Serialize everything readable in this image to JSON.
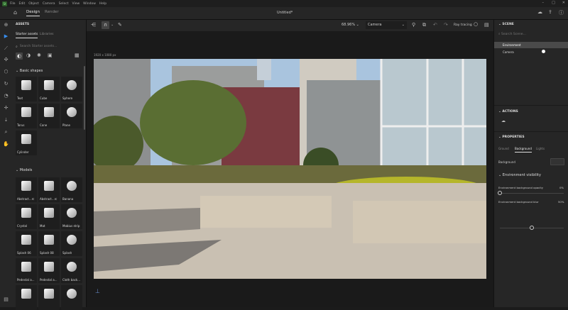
{
  "menu": {
    "items": [
      "File",
      "Edit",
      "Object",
      "Camera",
      "Select",
      "View",
      "Window",
      "Help"
    ]
  },
  "tabs": {
    "home": "home-icon",
    "items": [
      "Design",
      "Render"
    ],
    "active": "Design",
    "doc_title": "Untitled*"
  },
  "assets": {
    "header": "ASSETS",
    "tabs": [
      "Starter assets",
      "Libraries"
    ],
    "search_placeholder": "Search Starter assets...",
    "basic_title": "Basic shapes",
    "basic": [
      "Text",
      "Cube",
      "Sphere",
      "Torus",
      "Cone",
      "Plane",
      "Cylinder"
    ],
    "models_title": "Models",
    "models": [
      "Abstract...rc",
      "Abstract...rc",
      "Banana",
      "Crystal",
      "Mat",
      "Mobius strip",
      "Splash 06",
      "Splash 08",
      "Splash",
      "Pedestal a...",
      "Pedestal a...",
      "Cloth back...",
      "",
      "",
      ""
    ]
  },
  "toolbar": {
    "zoom": "68.96%",
    "camera": "Camera",
    "ray_tracing": "Ray tracing"
  },
  "viewport": {
    "resolution": "1920 x 1080 px"
  },
  "scene": {
    "header": "SCENE",
    "search_placeholder": "Search Scene...",
    "items": [
      "Environment",
      "Camera"
    ]
  },
  "actions": {
    "header": "ACTIONS"
  },
  "properties": {
    "header": "PROPERTIES",
    "tabs": [
      "Ground",
      "Background",
      "Lights"
    ],
    "active_tab": "Background",
    "background_label": "Background",
    "env_title": "Environment visibility",
    "opacity_label": "Environment background opacity",
    "opacity_value": "0%",
    "opacity": 0,
    "blur_label": "Environment background blur",
    "blur_value": "50%",
    "blur": 50
  },
  "colors": {
    "accent": "#378ef0",
    "bg": "#262626",
    "viewport": "#1a1a1a"
  }
}
